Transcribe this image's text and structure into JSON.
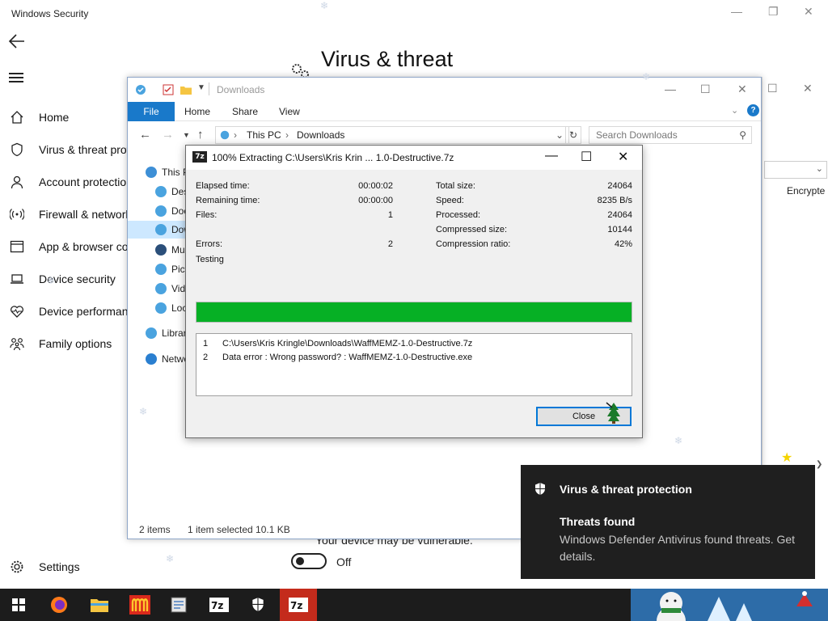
{
  "security": {
    "title": "Windows Security",
    "heading": "Virus & threat",
    "nav": [
      {
        "label": "Home",
        "icon": "home-icon"
      },
      {
        "label": "Virus & threat protection",
        "icon": "shield-icon"
      },
      {
        "label": "Account protection",
        "icon": "person-icon"
      },
      {
        "label": "Firewall & network protection",
        "icon": "wifi-antenna-icon"
      },
      {
        "label": "App & browser control",
        "icon": "browser-window-icon"
      },
      {
        "label": "Device security",
        "icon": "laptop-icon"
      },
      {
        "label": "Device performance & health",
        "icon": "heart-pulse-icon"
      },
      {
        "label": "Family options",
        "icon": "family-icon"
      }
    ],
    "settings": "Settings",
    "vulnerable": "Your device may be vulnerable.",
    "toggle_label": "Off"
  },
  "explorer": {
    "title": "Downloads",
    "tabs": [
      "File",
      "Home",
      "Share",
      "View"
    ],
    "breadcrumb": [
      "This PC",
      "Downloads"
    ],
    "search_placeholder": "Search Downloads",
    "tree": [
      {
        "label": "This PC",
        "color": "#3d8fd6"
      },
      {
        "label": "Desktop",
        "color": "#4aa3df"
      },
      {
        "label": "Documents",
        "color": "#4aa3df"
      },
      {
        "label": "Downloads",
        "color": "#4aa3df"
      },
      {
        "label": "Music",
        "color": "#2b4f7a"
      },
      {
        "label": "Pictures",
        "color": "#4aa3df"
      },
      {
        "label": "Videos",
        "color": "#4aa3df"
      },
      {
        "label": "Local Disk",
        "color": "#4aa3df"
      },
      {
        "label": "Libraries",
        "color": "#4aa3df"
      },
      {
        "label": "Network",
        "color": "#2a7fd0"
      }
    ],
    "status_items": "2 items",
    "status_selected": "1 item selected  10.1 KB",
    "column_right": "Encrypte"
  },
  "zip": {
    "title": "100% Extracting C:\\Users\\Kris Krin ... 1.0-Destructive.7z",
    "left_stats": [
      {
        "label": "Elapsed time:",
        "value": "00:00:02"
      },
      {
        "label": "Remaining time:",
        "value": "00:00:00"
      },
      {
        "label": "Files:",
        "value": "1"
      },
      {
        "label": "Errors:",
        "value": "2"
      }
    ],
    "right_stats": [
      {
        "label": "Total size:",
        "value": "24064"
      },
      {
        "label": "Speed:",
        "value": "8235 B/s"
      },
      {
        "label": "Processed:",
        "value": "24064"
      },
      {
        "label": "Compressed size:",
        "value": "10144"
      },
      {
        "label": "Compression ratio:",
        "value": "42%"
      }
    ],
    "status": "Testing",
    "progress": 1.0,
    "log": [
      {
        "n": "1",
        "text": "C:\\Users\\Kris Kringle\\Downloads\\WaffMEMZ-1.0-Destructive.7z"
      },
      {
        "n": "2",
        "text": "Data error : Wrong password? : WaffMEMZ-1.0-Destructive.exe"
      }
    ],
    "close_label": "Close",
    "progress_color": "#06b025"
  },
  "toast": {
    "header": "Virus & threat protection",
    "title": "Threats found",
    "body": "Windows Defender Antivirus found threats. Get details."
  },
  "taskbar": {
    "items": [
      "start-icon",
      "firefox-icon",
      "file-explorer-icon",
      "mcdonalds-icon",
      "notepad-icon",
      "7zip-icon",
      "windows-security-icon",
      "7zip-active-icon"
    ],
    "active_color": "#c42b1c"
  }
}
